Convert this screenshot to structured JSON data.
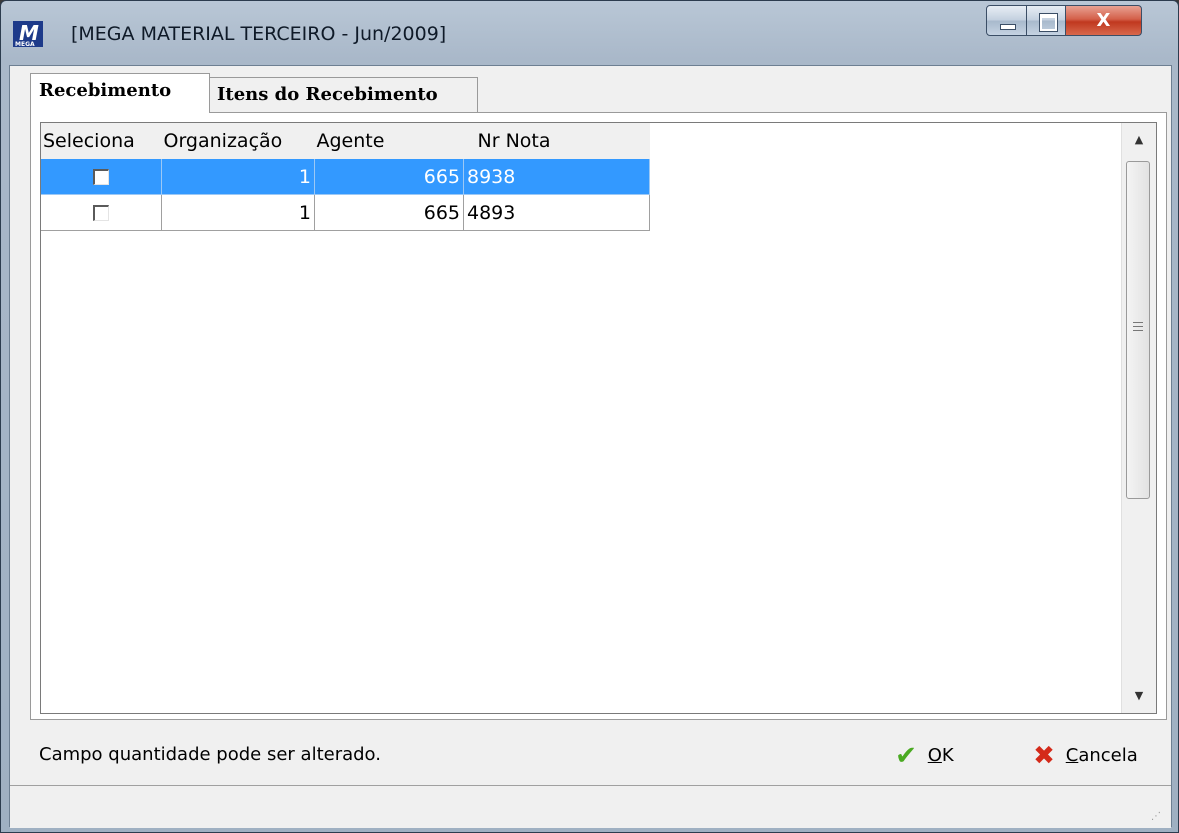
{
  "window": {
    "title": "[MEGA MATERIAL TERCEIRO - Jun/2009]",
    "app_icon_text": "M",
    "app_icon_subtext": "MEGA",
    "minimize_icon": "minimize-icon",
    "maximize_icon": "maximize-icon",
    "close_glyph": "X"
  },
  "tabs": [
    {
      "label": "Recebimento",
      "active": true
    },
    {
      "label": "Itens do Recebimento",
      "active": false
    }
  ],
  "grid": {
    "columns": [
      "Seleciona",
      "Organização",
      "Agente",
      "Nr Nota"
    ],
    "rows": [
      {
        "seleciona": false,
        "organizacao": "1",
        "agente": "665",
        "nr_nota": "8938",
        "selected": true
      },
      {
        "seleciona": false,
        "organizacao": "1",
        "agente": "665",
        "nr_nota": "4893",
        "selected": false
      }
    ]
  },
  "status": {
    "message": "Campo quantidade pode ser alterado."
  },
  "buttons": {
    "ok_underlined": "O",
    "ok_rest": "K",
    "cancel_underlined": "C",
    "cancel_rest": "ancela"
  },
  "colors": {
    "selection": "#3399ff",
    "ok_icon": "#4aaa22",
    "cancel_icon": "#d42a1a"
  }
}
